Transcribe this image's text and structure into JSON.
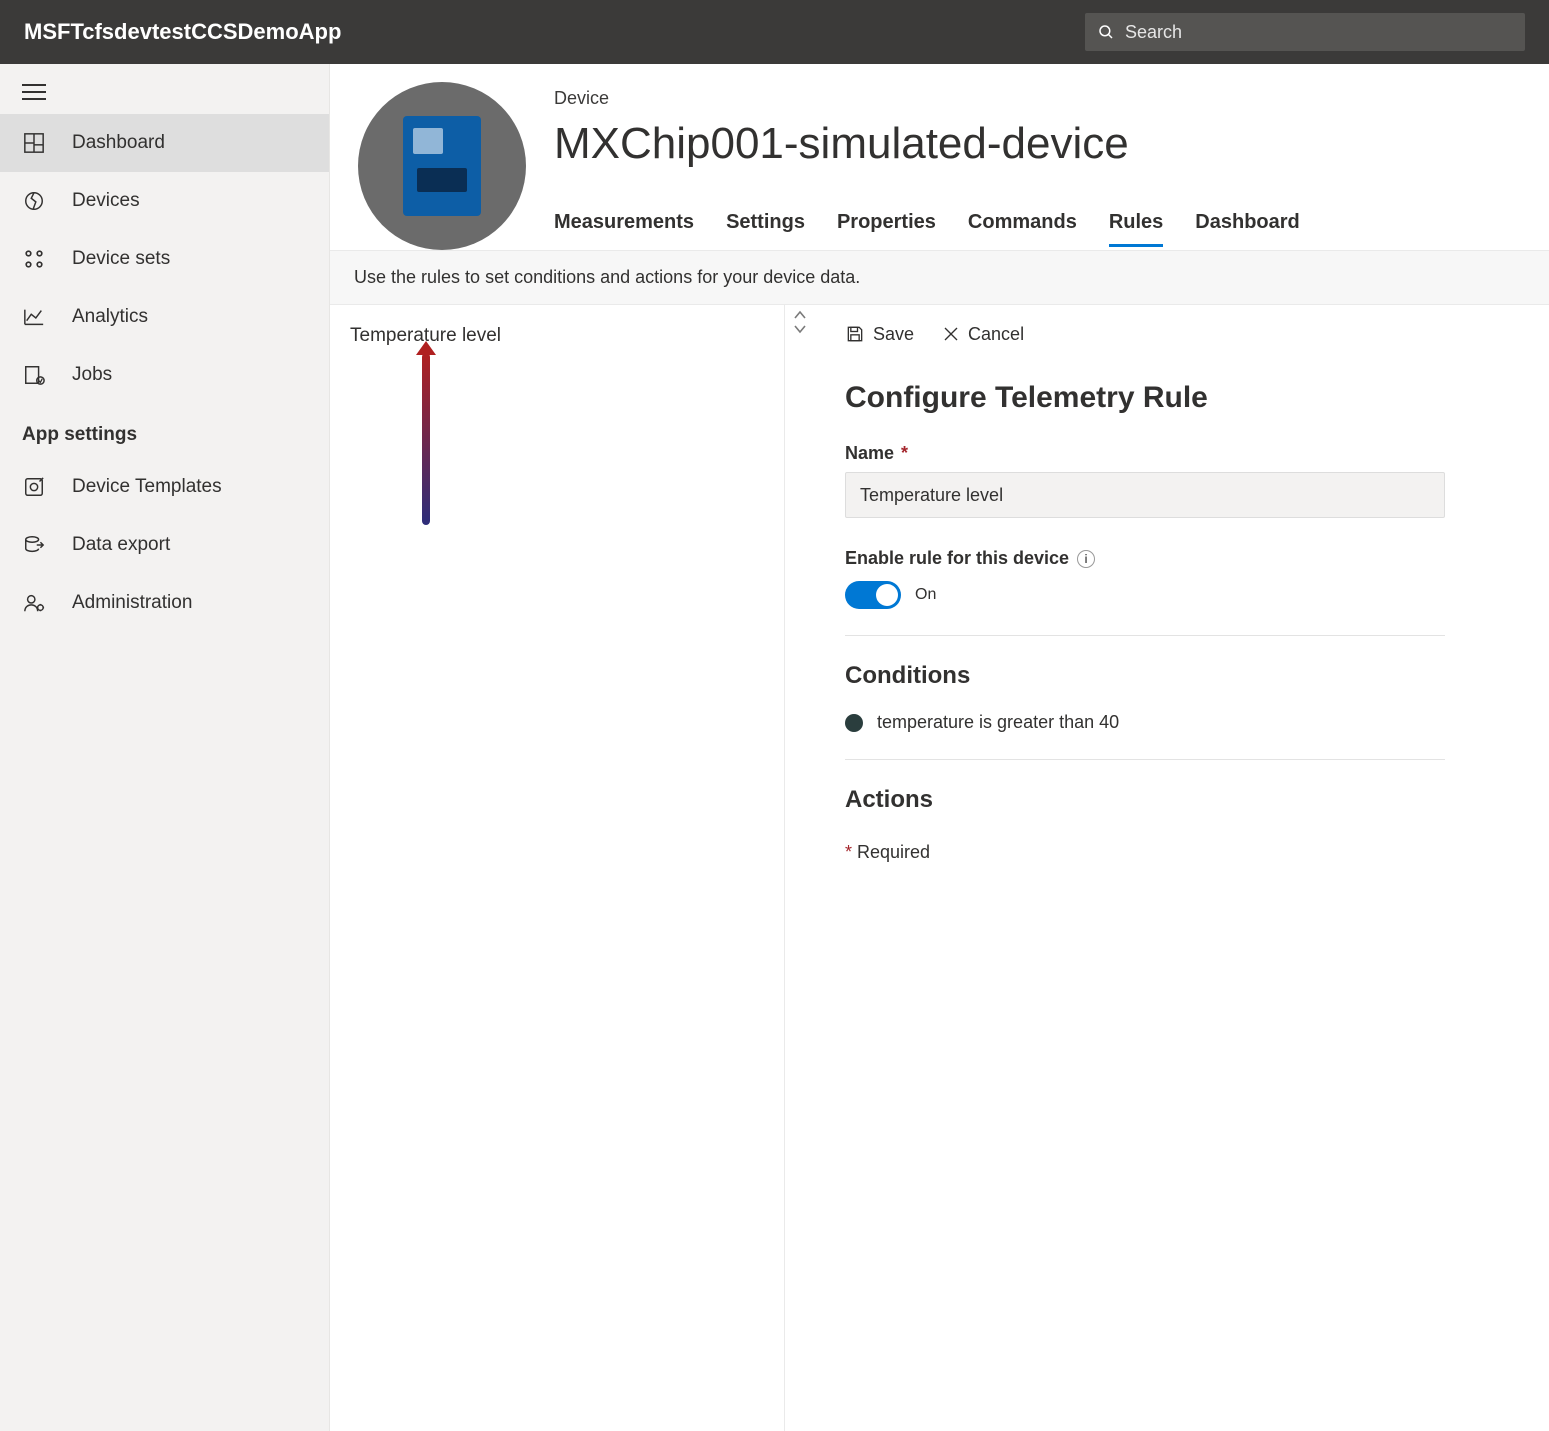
{
  "header": {
    "app_title": "MSFTcfsdevtestCCSDemoApp",
    "search_placeholder": "Search"
  },
  "sidebar": {
    "items": [
      {
        "key": "dashboard",
        "label": "Dashboard",
        "active": true
      },
      {
        "key": "devices",
        "label": "Devices"
      },
      {
        "key": "device-sets",
        "label": "Device sets"
      },
      {
        "key": "analytics",
        "label": "Analytics"
      },
      {
        "key": "jobs",
        "label": "Jobs"
      }
    ],
    "section_heading": "App settings",
    "settings_items": [
      {
        "key": "device-templates",
        "label": "Device Templates"
      },
      {
        "key": "data-export",
        "label": "Data export"
      },
      {
        "key": "administration",
        "label": "Administration"
      }
    ]
  },
  "device": {
    "label": "Device",
    "name": "MXChip001-simulated-device",
    "tabs": [
      {
        "key": "measurements",
        "label": "Measurements"
      },
      {
        "key": "settings",
        "label": "Settings"
      },
      {
        "key": "properties",
        "label": "Properties"
      },
      {
        "key": "commands",
        "label": "Commands"
      },
      {
        "key": "rules",
        "label": "Rules",
        "active": true
      },
      {
        "key": "dashboard",
        "label": "Dashboard"
      }
    ]
  },
  "info_text": "Use the rules to set conditions and actions for your device data.",
  "rules_list": [
    {
      "name": "Temperature level"
    }
  ],
  "toolbar": {
    "save_label": "Save",
    "cancel_label": "Cancel"
  },
  "rule_form": {
    "title": "Configure Telemetry Rule",
    "name_label": "Name",
    "name_value": "Temperature level",
    "enable_label": "Enable rule for this device",
    "toggle_state": "On",
    "conditions_heading": "Conditions",
    "conditions": [
      "temperature is greater than 40"
    ],
    "actions_heading": "Actions",
    "required_note": "Required"
  }
}
